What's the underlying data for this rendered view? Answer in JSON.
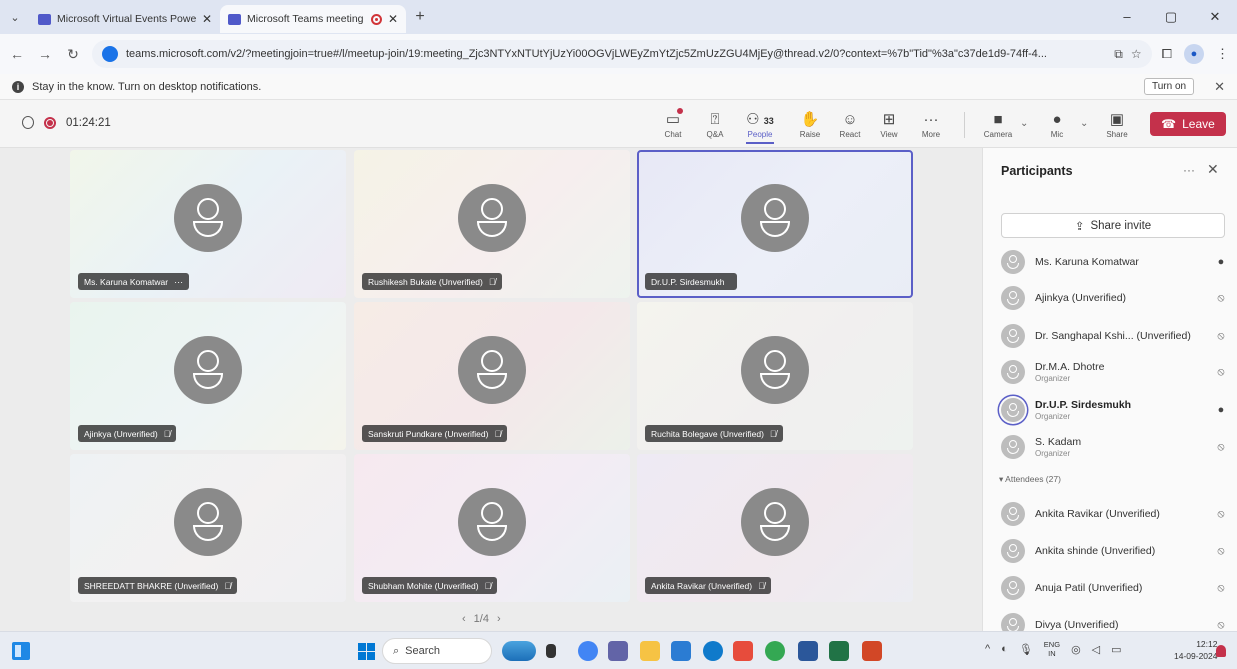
{
  "browser": {
    "tabs": [
      {
        "title": "Microsoft Virtual Events Powere",
        "active": false
      },
      {
        "title": "Microsoft Teams meeting |",
        "active": true
      }
    ],
    "url": "teams.microsoft.com/v2/?meetingjoin=true#/l/meetup-join/19:meeting_Zjc3NTYxNTUtYjUzYi00OGVjLWEyZmYtZjc5ZmUzZGU4MjEy@thread.v2/0?context=%7b\"Tid\"%3a\"c37de1d9-74ff-4...",
    "window_controls": [
      "–",
      "▢",
      "✕"
    ]
  },
  "notification": {
    "text": "Stay in the know. Turn on desktop notifications.",
    "button": "Turn on"
  },
  "meeting": {
    "timer": "01:24:21",
    "controls": {
      "chat": "Chat",
      "qa": "Q&A",
      "people": "People",
      "people_count": "33",
      "raise": "Raise",
      "react": "React",
      "view": "View",
      "more": "More",
      "camera": "Camera",
      "mic": "Mic",
      "share": "Share",
      "leave": "Leave"
    },
    "accent_color": "#5b5fc7",
    "leave_color": "#c4314b"
  },
  "grid": {
    "tiles": [
      {
        "name": "Ms. Karuna Komatwar",
        "suffix": "···",
        "selected": false,
        "bg": "linear-gradient(135deg,#f1f6ea 0%,#eaf2f6 50%,#efeaf3 100%)"
      },
      {
        "name": "Rushikesh Bukate (Unverified)",
        "suffix": "🎙̸",
        "selected": false,
        "bg": "linear-gradient(135deg,#f5f3e6 0%,#f6eeee 55%,#eef3ee 100%)"
      },
      {
        "name": "Dr.U.P. Sirdesmukh",
        "suffix": "",
        "selected": true,
        "bg": "linear-gradient(135deg,#e7e8f6 0%,#eceff8 55%,#e9edf5 100%)"
      },
      {
        "name": "Ajinkya (Unverified)",
        "suffix": "🎙̸",
        "selected": false,
        "bg": "linear-gradient(135deg,#e9f4ee 0%,#eef4f5 55%,#f4f4ec 100%)"
      },
      {
        "name": "Sanskruti Pundkare (Unverified)",
        "suffix": "🎙̸",
        "selected": false,
        "bg": "linear-gradient(135deg,#f6ece6 0%,#f4e8ea 55%,#ecf1ea 100%)"
      },
      {
        "name": "Ruchita Bolegave (Unverified)",
        "suffix": "🎙̸",
        "selected": false,
        "bg": "linear-gradient(135deg,#f4f4ee 0%,#f1efef 55%,#eef2ef 100%)"
      },
      {
        "name": "SHREEDATT BHAKRE (Unverified)",
        "suffix": "🎙̸",
        "selected": false,
        "bg": "linear-gradient(135deg,#eef2f4 0%,#f3f1f1 55%,#efeff2 100%)"
      },
      {
        "name": "Shubham Mohite (Unverified)",
        "suffix": "🎙̸",
        "selected": false,
        "bg": "linear-gradient(135deg,#f6e9ef 0%,#f3ecf4 55%,#eaf0f4 100%)"
      },
      {
        "name": "Ankita Ravikar (Unverified)",
        "suffix": "🎙̸",
        "selected": false,
        "bg": "linear-gradient(135deg,#eeeaf4 0%,#f1e9ee 55%,#ecedf2 100%)"
      }
    ],
    "pager": {
      "prev": "‹",
      "label": "1/4",
      "next": "›"
    }
  },
  "participants": {
    "title": "Participants",
    "share_invite": "Share invite",
    "people": [
      {
        "name": "Ms. Karuna Komatwar",
        "role": "",
        "mic": "on",
        "bold": false,
        "ring": false
      },
      {
        "name": "Ajinkya (Unverified)",
        "role": "",
        "mic": "off",
        "bold": false,
        "ring": false
      },
      {
        "name": "Dr. Sanghapal Kshi... (Unverified)",
        "role": "",
        "mic": "off",
        "bold": false,
        "ring": false
      },
      {
        "name": "Dr.M.A. Dhotre",
        "role": "Organizer",
        "mic": "off",
        "bold": false,
        "ring": false
      },
      {
        "name": "Dr.U.P. Sirdesmukh",
        "role": "Organizer",
        "mic": "on",
        "bold": true,
        "ring": true
      },
      {
        "name": "S. Kadam",
        "role": "Organizer",
        "mic": "off",
        "bold": false,
        "ring": false
      }
    ],
    "attendees_label": "▾ Attendees (27)",
    "attendees": [
      {
        "name": "Ankita Ravikar (Unverified)",
        "mic": "off"
      },
      {
        "name": "Ankita shinde (Unverified)",
        "mic": "off"
      },
      {
        "name": "Anuja Patil (Unverified)",
        "mic": "off"
      },
      {
        "name": "Divya (Unverified)",
        "mic": "off"
      }
    ]
  },
  "taskbar": {
    "search": "Search",
    "lang_top": "ENG",
    "lang_bottom": "IN",
    "time": "12:12",
    "date": "14-09-2024"
  }
}
